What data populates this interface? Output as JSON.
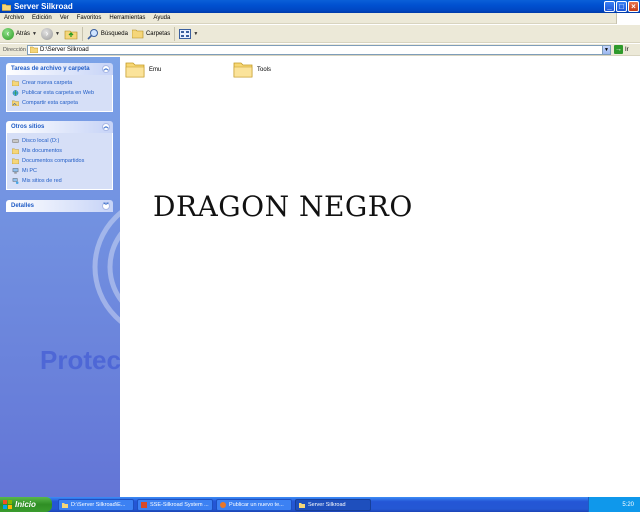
{
  "window": {
    "title": "Server Silkroad",
    "title_icon": "folder-icon"
  },
  "menubar": {
    "items": [
      "Archivo",
      "Edición",
      "Ver",
      "Favoritos",
      "Herramientas",
      "Ayuda"
    ]
  },
  "toolbar": {
    "back_label": "Atrás",
    "search_label": "Búsqueda",
    "folders_label": "Carpetas"
  },
  "address": {
    "label": "Dirección",
    "value": "D:\\Server Silkroad",
    "go_label": "Ir"
  },
  "taskpane": {
    "panels": [
      {
        "title": "Tareas de archivo y carpeta",
        "items": [
          {
            "label": "Crear nueva carpeta",
            "icon": "new-folder-icon"
          },
          {
            "label": "Publicar esta carpeta en Web",
            "icon": "globe-icon"
          },
          {
            "label": "Compartir esta carpeta",
            "icon": "share-folder-icon"
          }
        ]
      },
      {
        "title": "Otros sitios",
        "items": [
          {
            "label": "Disco local (D:)",
            "icon": "drive-icon"
          },
          {
            "label": "Mis documentos",
            "icon": "folder-icon"
          },
          {
            "label": "Documentos compartidos",
            "icon": "folder-icon"
          },
          {
            "label": "Mi PC",
            "icon": "computer-icon"
          },
          {
            "label": "Mis sitios de red",
            "icon": "network-icon"
          }
        ]
      },
      {
        "title": "Detalles",
        "items": []
      }
    ],
    "watermark_text": "Protec"
  },
  "content": {
    "folders": [
      {
        "name": "Emu"
      },
      {
        "name": "Tools"
      }
    ],
    "overlay_text": "DRAGON NEGRO"
  },
  "taskbar": {
    "start_label": "Inicio",
    "buttons": [
      {
        "label": "D:\\Server Silkroad\\E...",
        "active": false
      },
      {
        "label": "SSE-Silkroad System ...",
        "active": false
      },
      {
        "label": "Publicar un nuevo te...",
        "active": false
      },
      {
        "label": "Server Silkroad",
        "active": true
      }
    ],
    "clock": "5:20"
  },
  "colors": {
    "titlebar": "#0050d0",
    "taskpane": "#7ba2e7",
    "taskpane_link": "#215dc6",
    "taskbar": "#2456d6",
    "start_button": "#3a9c2e"
  }
}
